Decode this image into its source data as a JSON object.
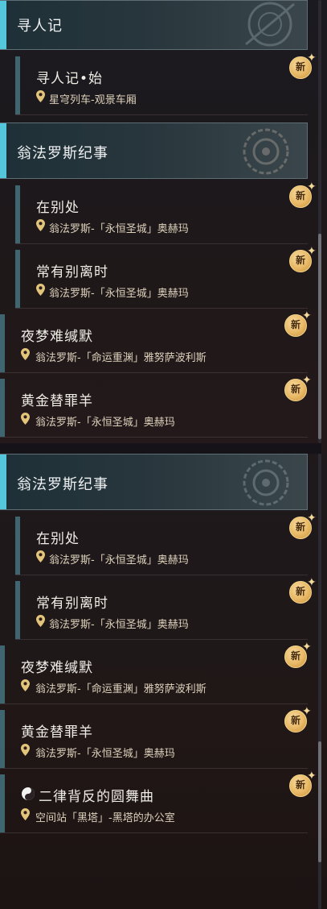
{
  "badge_label": "新",
  "colors": {
    "header_accent": "#55c7dd",
    "quest_bar": "#3f6670",
    "badge_gold": "#e8b865"
  },
  "panel_top": {
    "header1": "寻人记",
    "quest1": {
      "name": "寻人记•始",
      "location": "星穹列车-观景车厢"
    },
    "header2": "翁法罗斯纪事",
    "quest2": {
      "name": "在别处",
      "location": "翁法罗斯-「永恒圣城」奥赫玛"
    },
    "quest3": {
      "name": "常有别离时",
      "location": "翁法罗斯-「永恒圣城」奥赫玛"
    },
    "quest4": {
      "name": "夜梦难缄默",
      "location": "翁法罗斯-「命运重渊」雅努萨波利斯"
    },
    "quest5": {
      "name": "黄金替罪羊",
      "location": "翁法罗斯-「永恒圣城」奥赫玛"
    }
  },
  "panel_bottom": {
    "header": "翁法罗斯纪事",
    "quest1": {
      "name": "在别处",
      "location": "翁法罗斯-「永恒圣城」奥赫玛"
    },
    "quest2": {
      "name": "常有别离时",
      "location": "翁法罗斯-「永恒圣城」奥赫玛"
    },
    "quest3": {
      "name": "夜梦难缄默",
      "location": "翁法罗斯-「命运重渊」雅努萨波利斯"
    },
    "quest4": {
      "name": "黄金替罪羊",
      "location": "翁法罗斯-「永恒圣城」奥赫玛"
    },
    "quest5": {
      "name": "二律背反的圆舞曲",
      "location": "空间站「黑塔」-黑塔的办公室"
    }
  }
}
